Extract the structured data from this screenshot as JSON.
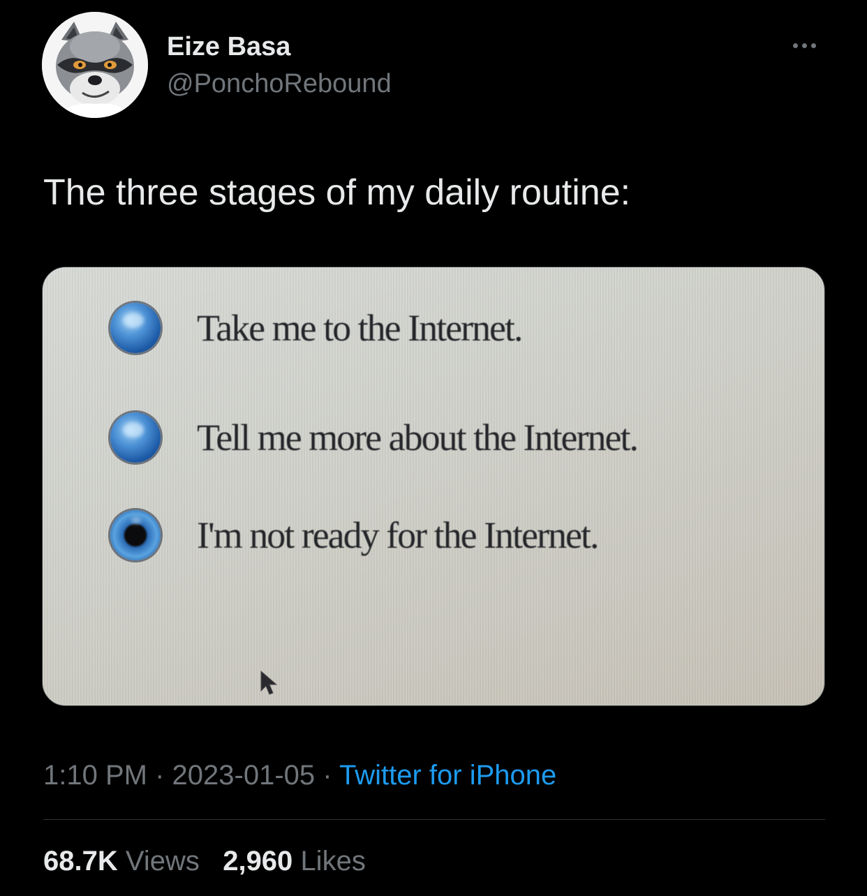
{
  "author": {
    "display_name": "Eize Basa",
    "handle": "@PonchoRebound",
    "avatar_icon": "raccoon-avatar-icon"
  },
  "menu": {
    "icon": "more-horizontal-icon"
  },
  "tweet": {
    "text": "The three stages of my daily routine:"
  },
  "media": {
    "options": [
      {
        "label": "Take me to the Internet.",
        "selected": false
      },
      {
        "label": "Tell me more about the Internet.",
        "selected": false
      },
      {
        "label": "I'm not ready for the Internet.",
        "selected": true
      }
    ],
    "cursor_icon": "mouse-pointer-icon"
  },
  "meta": {
    "time": "1:10 PM",
    "separator": "·",
    "date": "2023-01-05",
    "source": "Twitter for iPhone"
  },
  "stats": {
    "views_count": "68.7K",
    "views_label": "Views",
    "likes_count": "2,960",
    "likes_label": "Likes"
  },
  "colors": {
    "background": "#000000",
    "text_primary": "#e7e9ea",
    "text_secondary": "#71767b",
    "link": "#1d9bf0",
    "divider": "#2f3336"
  }
}
